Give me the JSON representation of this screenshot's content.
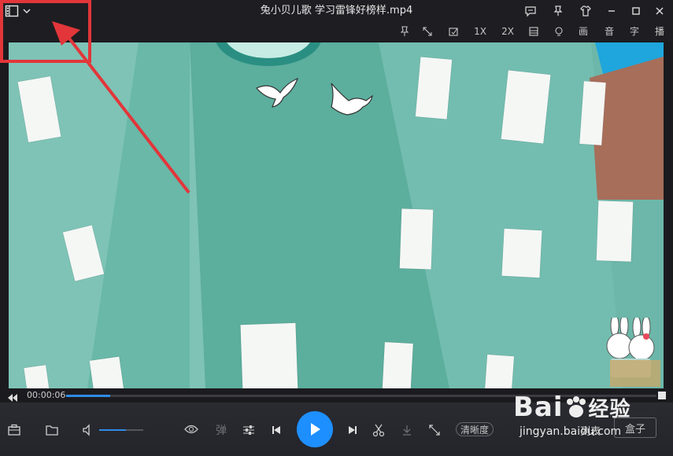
{
  "window": {
    "title": "兔小贝儿歌 学习雷锋好榜样.mp4"
  },
  "titlebar": {
    "menu_icon": "film-menu-icon",
    "dropdown_icon": "chevron-down-icon",
    "controls": [
      "message-icon",
      "pin-icon",
      "skin-icon",
      "minimize-icon",
      "maximize-icon",
      "close-icon"
    ]
  },
  "toolbar": {
    "speed_1x": "1X",
    "speed_2x": "2X",
    "picture_label": "画",
    "audio_label": "音",
    "subtitle_label": "字",
    "play_label": "播"
  },
  "player": {
    "current_time": "00:00:06",
    "progress_fraction": 0.074,
    "volume_fraction": 0.6,
    "danmaku_label": "弹",
    "quality_label": "清晰度",
    "playlist_label": "列表",
    "box_label": "盒子"
  },
  "watermark": {
    "brand": "Bai",
    "brand_cn": "经验",
    "url": "jingyan.baidu.com"
  },
  "colors": {
    "accent": "#1e8fff",
    "highlight": "#e2363a",
    "video_bg": "#79c2b4"
  }
}
